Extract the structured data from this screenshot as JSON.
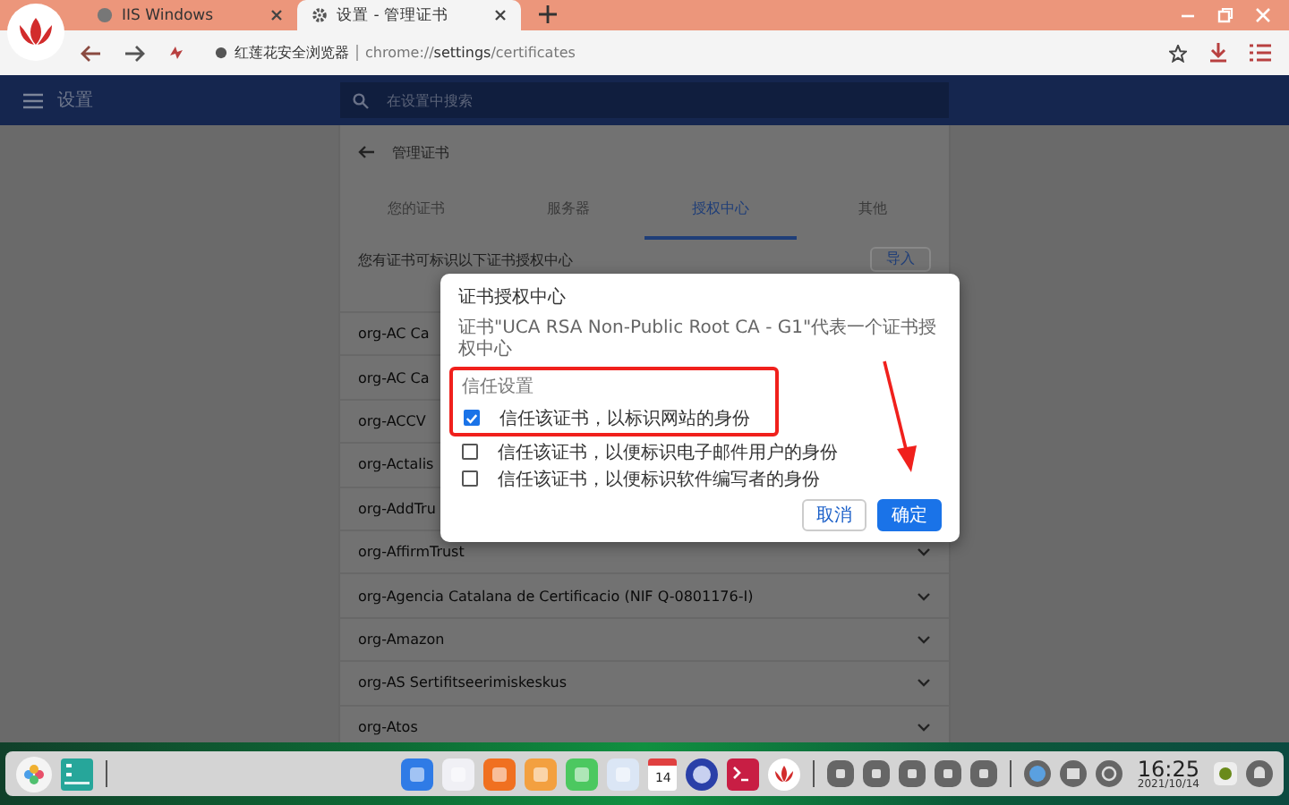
{
  "browser": {
    "tabs": [
      {
        "title": "IIS Windows",
        "selected": false
      },
      {
        "title": "设置 - 管理证书",
        "selected": true
      }
    ],
    "site_label": "红莲花安全浏览器",
    "url": "chrome://**settings**/certificates"
  },
  "header": {
    "title": "设置",
    "search": {
      "placeholder": "在设置中搜索"
    }
  },
  "page": {
    "title": "管理证书",
    "tabs": [
      {
        "label": "您的证书",
        "selected": false
      },
      {
        "label": "服务器",
        "selected": false
      },
      {
        "label": "授权中心",
        "selected": true
      },
      {
        "label": "其他",
        "selected": false
      }
    ],
    "intro": "您有证书可标识以下证书授权中心",
    "import_button": "导入",
    "rows": [
      "org-AC Ca",
      "org-AC Ca",
      "org-ACCV",
      "org-Actalis",
      "org-AddTru",
      "org-AffirmTrust",
      "org-Agencia Catalana de Certificacio (NIF Q-0801176-I)",
      "org-Amazon",
      "org-AS Sertifitseerimiskeskus",
      "org-Atos"
    ]
  },
  "dialog": {
    "title": "证书授权中心",
    "description": "证书\"UCA RSA Non-Public Root CA - G1\"代表一个证书授权中心",
    "section": "信任设置",
    "options": [
      {
        "label": "信任该证书，以标识网站的身份",
        "checked": true
      },
      {
        "label": "信任该证书，以便标识电子邮件用户的身份",
        "checked": false
      },
      {
        "label": "信任该证书，以便标识软件编写者的身份",
        "checked": false
      }
    ],
    "cancel": "取消",
    "ok": "确定"
  },
  "taskbar": {
    "calendar_day": "14",
    "time": "16:25",
    "date": "2021/10/14"
  }
}
